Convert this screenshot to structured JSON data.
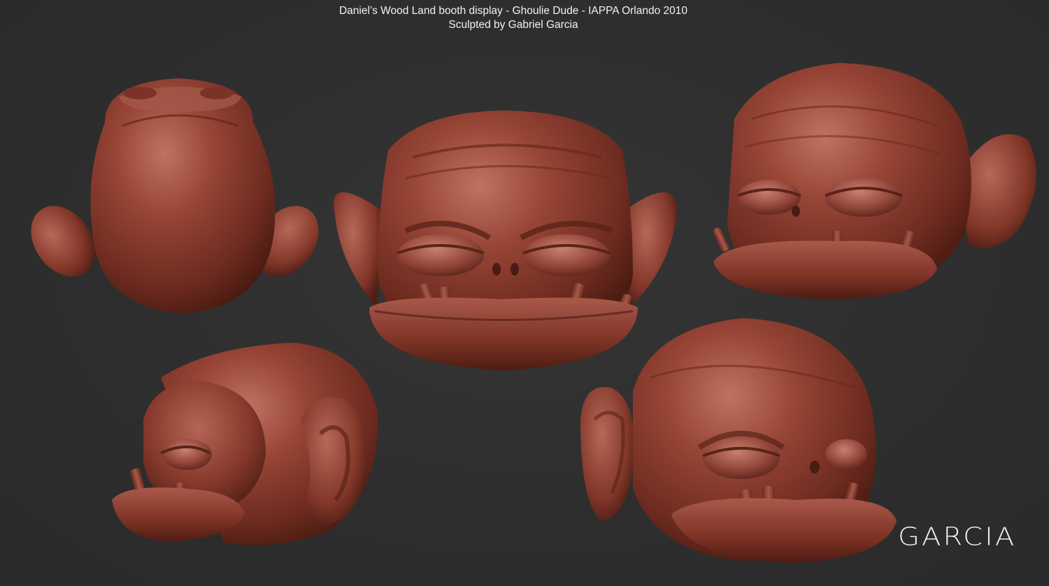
{
  "caption": {
    "line1": "Daniel’s Wood Land booth display - Ghoulie Dude - IAPPA Orlando 2010",
    "line2": "Sculpted by Gabriel Garcia"
  },
  "signature": "GARCIA",
  "colors": {
    "background": "#2e2e2e",
    "sculpt_base": "#8e3f32",
    "sculpt_highlight": "#b86a5a",
    "sculpt_shadow": "#4a1c15",
    "text": "#f2f2f2"
  },
  "views": [
    {
      "name": "top view"
    },
    {
      "name": "front view"
    },
    {
      "name": "three-quarter left view"
    },
    {
      "name": "side profile view"
    },
    {
      "name": "three-quarter right low view"
    }
  ]
}
